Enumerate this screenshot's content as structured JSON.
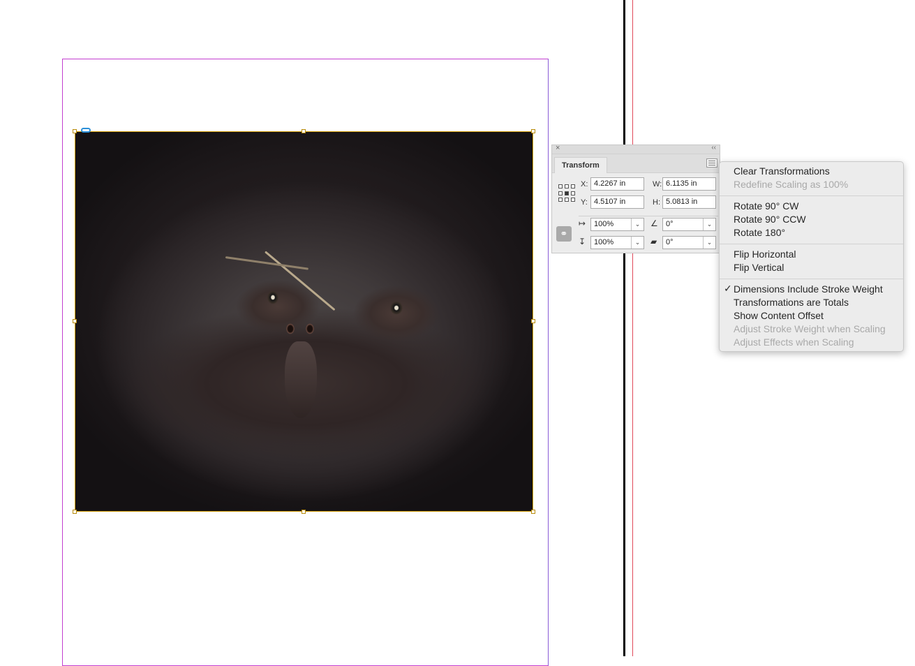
{
  "document": {
    "image_alt": "snapping turtle photo"
  },
  "transform_panel": {
    "tab_label": "Transform",
    "close_glyph": "×",
    "collapse_glyph": "‹‹",
    "x_label": "X:",
    "x_value": "4.2267 in",
    "y_label": "Y:",
    "y_value": "4.5107 in",
    "w_label": "W:",
    "w_value": "6.1135 in",
    "h_label": "H:",
    "h_value": "5.0813 in",
    "scale_x": "100%",
    "scale_y": "100%",
    "rotation": "0°",
    "shear": "0°",
    "icons": [
      "reference-point-icon",
      "constrain-proportions-icon",
      "scale-x-icon",
      "scale-y-icon",
      "rotation-angle-icon",
      "shear-angle-icon",
      "panel-menu-icon"
    ]
  },
  "flyout_menu": {
    "groups": [
      [
        {
          "label": "Clear Transformations",
          "enabled": true
        },
        {
          "label": "Redefine Scaling as 100%",
          "enabled": false
        }
      ],
      [
        {
          "label": "Rotate 90° CW",
          "enabled": true
        },
        {
          "label": "Rotate 90° CCW",
          "enabled": true
        },
        {
          "label": "Rotate 180°",
          "enabled": true
        }
      ],
      [
        {
          "label": "Flip Horizontal",
          "enabled": true
        },
        {
          "label": "Flip Vertical",
          "enabled": true
        }
      ],
      [
        {
          "label": "Dimensions Include Stroke Weight",
          "enabled": true,
          "checked": true
        },
        {
          "label": "Transformations are Totals",
          "enabled": true
        },
        {
          "label": "Show Content Offset",
          "enabled": true
        },
        {
          "label": "Adjust Stroke Weight when Scaling",
          "enabled": false
        },
        {
          "label": "Adjust Effects when Scaling",
          "enabled": false
        }
      ]
    ],
    "check_glyph": "✓"
  },
  "colors": {
    "margin_guide": "#c23ed0",
    "bleed_guide": "#e0485a",
    "frame_selection": "#d6a10a",
    "link_badge": "#2a8fd8"
  }
}
